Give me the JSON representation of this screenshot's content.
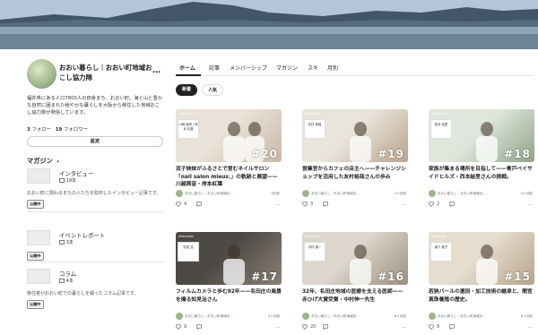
{
  "profile": {
    "name": "おおい暮らし｜おおい町地域おこし協力隊",
    "more": "…",
    "bio": "福井県にある人口7800人の田舎まち、おおい町。海と山と豊かな自然に囲まれた穏やかな暮らしを大阪から移住した地域おこし協力隊が発信しています。",
    "following_count": "3",
    "following_label": "フォロー",
    "followers_count": "19",
    "followers_label": "フォロワー",
    "settings_label": "設定"
  },
  "magazines": {
    "heading": "マガジン",
    "chevron": "›",
    "items": [
      {
        "name": "インタビュー",
        "count": "19本",
        "desc": "おおい町に関わるまちの人たちを取材したインタビュー記事です。",
        "badge": "公開中"
      },
      {
        "name": "イベントレポート",
        "count": "3本",
        "desc": "",
        "badge": "公開中"
      },
      {
        "name": "コラム",
        "count": "4本",
        "desc": "移住者がおおい町での暮らしを綴ったコラム記事です。",
        "badge": "公開中"
      }
    ]
  },
  "tabs": [
    "ホーム",
    "記事",
    "メンバーシップ",
    "マガジン",
    "スキ",
    "月別"
  ],
  "filters": [
    "新着",
    "人気"
  ],
  "cards": [
    {
      "tag": "interview",
      "label": "川崎 亜希 / 岸本 紅葉",
      "number": "#20",
      "title": "双子姉妹がふるさとで営むネイルサロン「nail salon mieux.」の軌跡と展望——川越茜音・岸本紅葉",
      "author": "おおい暮らし｜おおい町地域お…",
      "ago": "9日前",
      "likes": "4",
      "colors": [
        "#e8e2d8",
        "#c9b9a6"
      ]
    },
    {
      "tag": "interview",
      "label": "友村 裕哉",
      "number": "#19",
      "title": "営業官からカフェの店主へ——チャレンジショップを活用した友村裕哉さんの歩み",
      "author": "おおい暮らし｜おおい町地域お…",
      "ago": "1ヶ月前",
      "likes": "3",
      "colors": [
        "#e9e4dc",
        "#b9a48a"
      ]
    },
    {
      "tag": "interview",
      "label": "西本 結里",
      "number": "#18",
      "title": "家族が集まる場所を目指して——青戸ベイサイドヒルズ・西本結里さんの挑戦。",
      "author": "おおい暮らし｜おおい町地域お…",
      "ago": "4ヶ月前",
      "likes": "2",
      "colors": [
        "#dfe7dc",
        "#8fa487"
      ]
    },
    {
      "tag": "interview",
      "label": "知見 浩",
      "number": "#17",
      "title": "フィルムカメラと歩む92年——名田庄の風景を撮る知見治さん",
      "author": "おおい暮らし｜おおい町地域お…",
      "ago": "5ヶ月前",
      "likes": "9",
      "colors": [
        "#4d4a45",
        "#8a8276"
      ]
    },
    {
      "tag": "interview",
      "label": "中村 康一",
      "number": "#16",
      "title": "32年、名田庄地域の医療を支える医師——赤ひげ大賞受賞・中村伸一先生",
      "author": "おおい暮らし｜おおい町地域お…",
      "ago": "6ヶ月前",
      "likes": "20",
      "colors": [
        "#dcd6cc",
        "#9c8f7e"
      ]
    },
    {
      "tag": "interview",
      "label": "森下 麗子",
      "number": "#15",
      "title": "若狭パールの選別・加工技術の継承と、間宮真珠養殖の歴史。",
      "author": "おおい暮らし｜おおい町地域お…",
      "ago": "8ヶ月前",
      "likes": "8",
      "colors": [
        "#e6ddcf",
        "#b8a58a"
      ]
    }
  ]
}
